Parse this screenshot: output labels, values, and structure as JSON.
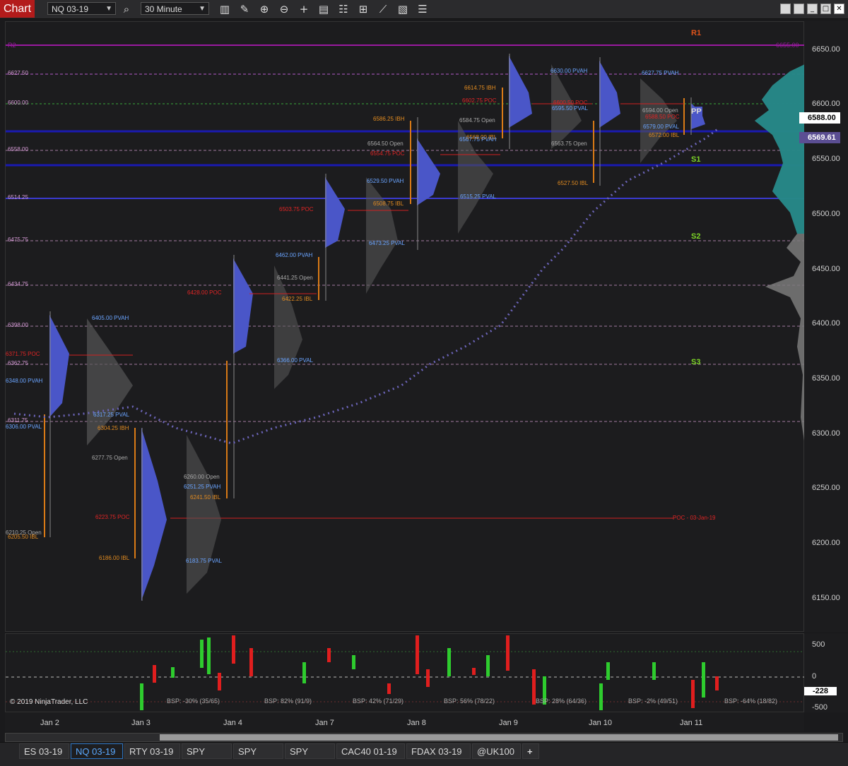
{
  "toolbar": {
    "title": "Chart",
    "instrument": "NQ 03-19",
    "interval": "30 Minute",
    "icons": [
      "search-icon",
      "bar-type-icon",
      "draw-tools-icon",
      "zoom-in-icon",
      "zoom-out-icon",
      "crosshair-icon",
      "data-box-icon",
      "properties-icon",
      "strategies-icon",
      "indicators-icon",
      "chart-trader-icon",
      "templates-icon"
    ],
    "window_buttons": [
      "panel-icon",
      "panel-icon",
      "minimize",
      "maximize",
      "close"
    ]
  },
  "price_axis": {
    "ticks": [
      "6650.00",
      "6600.00",
      "6550.00",
      "6500.00",
      "6450.00",
      "6400.00",
      "6350.00",
      "6300.00",
      "6250.00",
      "6200.00",
      "6150.00"
    ],
    "last_price": "6588.00",
    "vwap_price": "6569.61"
  },
  "sub_axis": {
    "ticks": [
      "500",
      "0",
      "-228",
      "-500"
    ]
  },
  "time_axis": {
    "labels": [
      "Jan 2",
      "Jan 3",
      "Jan 4",
      "Jan 7",
      "Jan 8",
      "Jan 9",
      "Jan 10",
      "Jan 11"
    ]
  },
  "level_labels": [
    "6627.50",
    "6600.00",
    "6558.00",
    "6514.25",
    "6475.75",
    "6434.75",
    "6398.00",
    "6362.75",
    "6311.75",
    "R2",
    "S1",
    "S2",
    "S3",
    "R1",
    "PP",
    "6655.00"
  ],
  "profile_labels": {
    "jan2": [
      "6371.75 POC",
      "6348.00 PVAH",
      "6306.00 PVAL",
      "6210.25 Open",
      "6205.50 IBL"
    ],
    "jan3": [
      "6405.00 PVAH",
      "6317.25 PVAL",
      "6304.25 IBH",
      "6277.75 Open",
      "6223.75 POC",
      "6186.00 IBL"
    ],
    "jan4": [
      "6428.00 POC",
      "6260.00 Open",
      "6251.25 PVAH",
      "6241.50 IBL",
      "6183.75 PVAL"
    ],
    "jan7": [
      "6462.00 PVAH",
      "6441.25 Open",
      "6422.25 IBL",
      "6366.00 PVAL",
      "6503.75 POC"
    ],
    "jan8": [
      "6586.25 IBH",
      "6564.50 Open",
      "6554.75 POC",
      "6529.50 PVAH",
      "6508.75 IBL",
      "6473.25 PVAL"
    ],
    "jan9": [
      "6614.75 IBH",
      "6602.75 POC",
      "6584.75 Open",
      "6568.00 IBL",
      "6567.75 PVAH",
      "6515.25 PVAL"
    ],
    "jan10": [
      "6630.00 PVAH",
      "6600.50 POC",
      "6595.50 PVAL",
      "6563.75 Open",
      "6527.50 IBL"
    ],
    "jan11": [
      "6627.75 PVAH",
      "6594.00 Open",
      "6588.50 POC",
      "6579.00 PVAL",
      "6572.00 IBL"
    ],
    "poc_ray": "POC - 03-Jan-19"
  },
  "bsp_labels": [
    "BSP: -30% (35/65)",
    "BSP: 82% (91/9)",
    "BSP: 42% (71/29)",
    "BSP: 56% (78/22)",
    "BSP: 28% (64/36)",
    "BSP: -2% (49/51)",
    "BSP: -64% (18/82)"
  ],
  "copyright": "© 2019 NinjaTrader, LLC",
  "tabs": [
    "ES 03-19",
    "NQ 03-19",
    "RTY 03-19",
    "SPY",
    "SPY",
    "SPY",
    "CAC40 01-19",
    "FDAX 03-19",
    "@UK100",
    "+"
  ],
  "active_tab": "NQ 03-19",
  "colors": {
    "bull": "#2ecc2e",
    "bear": "#e01e1e",
    "profile_blue": "#4a56c8",
    "vwap": "#6b64b8",
    "accent_red": "#b31b1b",
    "tab_active": "#5aa9ff"
  }
}
